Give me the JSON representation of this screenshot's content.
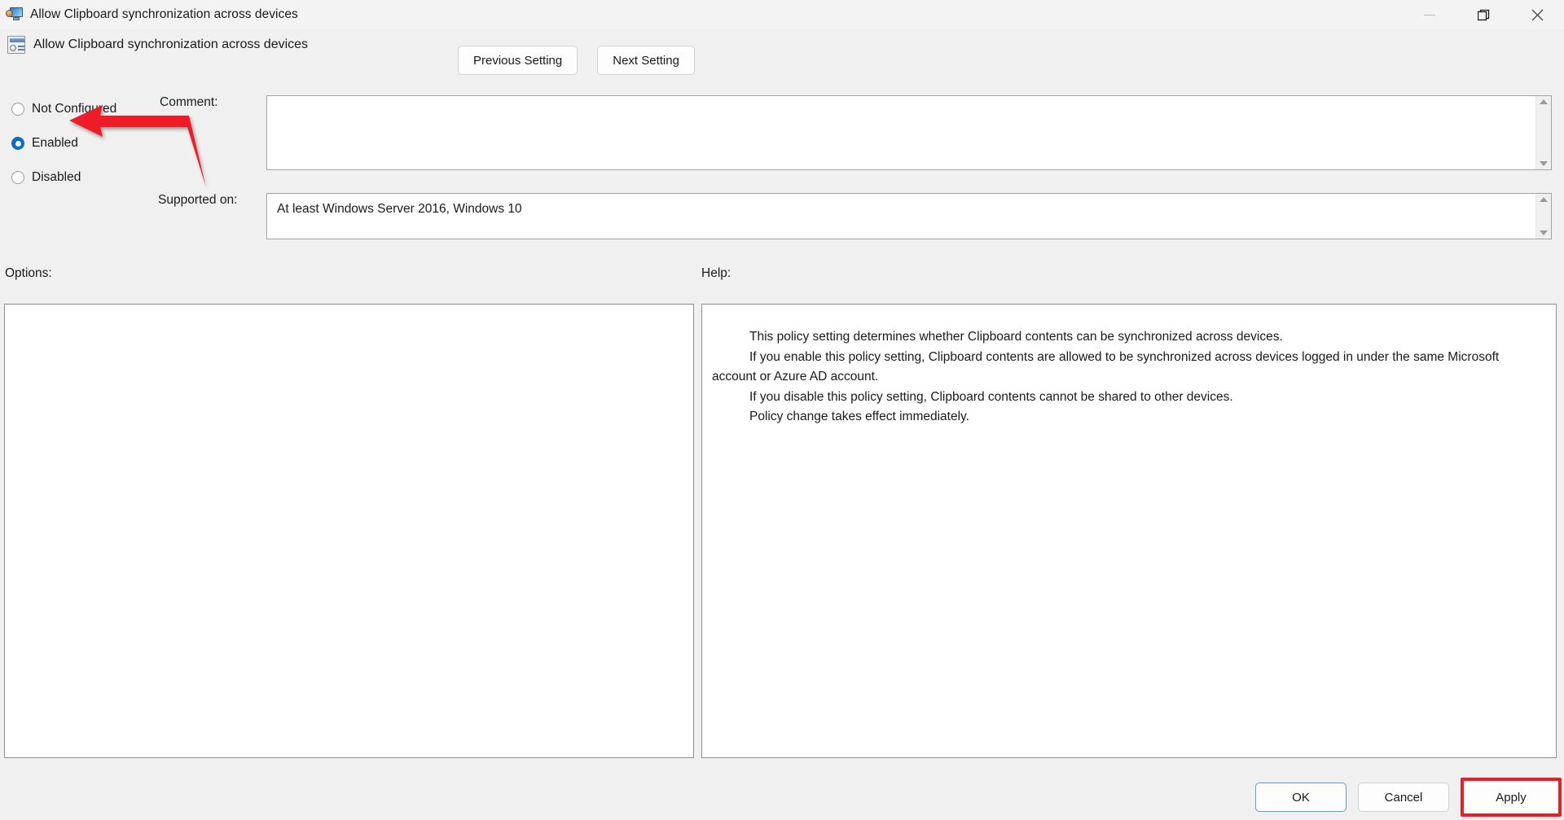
{
  "window": {
    "title": "Allow Clipboard synchronization across devices",
    "icon": "monitor-user-icon",
    "controls": {
      "minimize": "minimize-icon",
      "restore": "restore-icon",
      "close": "close-icon"
    }
  },
  "header": {
    "policy_icon": "policy-setting-icon",
    "policy_title": "Allow Clipboard synchronization across devices",
    "previous_setting": "Previous Setting",
    "next_setting": "Next Setting"
  },
  "state": {
    "options": [
      {
        "id": "not-configured",
        "label": "Not Configured",
        "selected": false
      },
      {
        "id": "enabled",
        "label": "Enabled",
        "selected": true
      },
      {
        "id": "disabled",
        "label": "Disabled",
        "selected": false
      }
    ],
    "selected_value": "Enabled"
  },
  "fields": {
    "comment_label": "Comment:",
    "comment_value": "",
    "supported_label": "Supported on:",
    "supported_value": "At least Windows Server 2016, Windows 10"
  },
  "sections": {
    "options_label": "Options:",
    "help_label": "Help:",
    "options_content": ""
  },
  "help": {
    "paragraphs": [
      "This policy setting determines whether Clipboard contents can be synchronized across devices.",
      "If you enable this policy setting, Clipboard contents are allowed to be synchronized across devices logged in under the same Microsoft account or Azure AD account.",
      "If you disable this policy setting, Clipboard contents cannot be shared to other devices.",
      "Policy change takes effect immediately."
    ]
  },
  "footer": {
    "ok": "OK",
    "cancel": "Cancel",
    "apply": "Apply"
  },
  "annotations": {
    "arrow_color": "#ee1c25",
    "arrow_target": "Enabled",
    "highlight_color": "#ee1c25",
    "highlight_target": "Apply"
  }
}
